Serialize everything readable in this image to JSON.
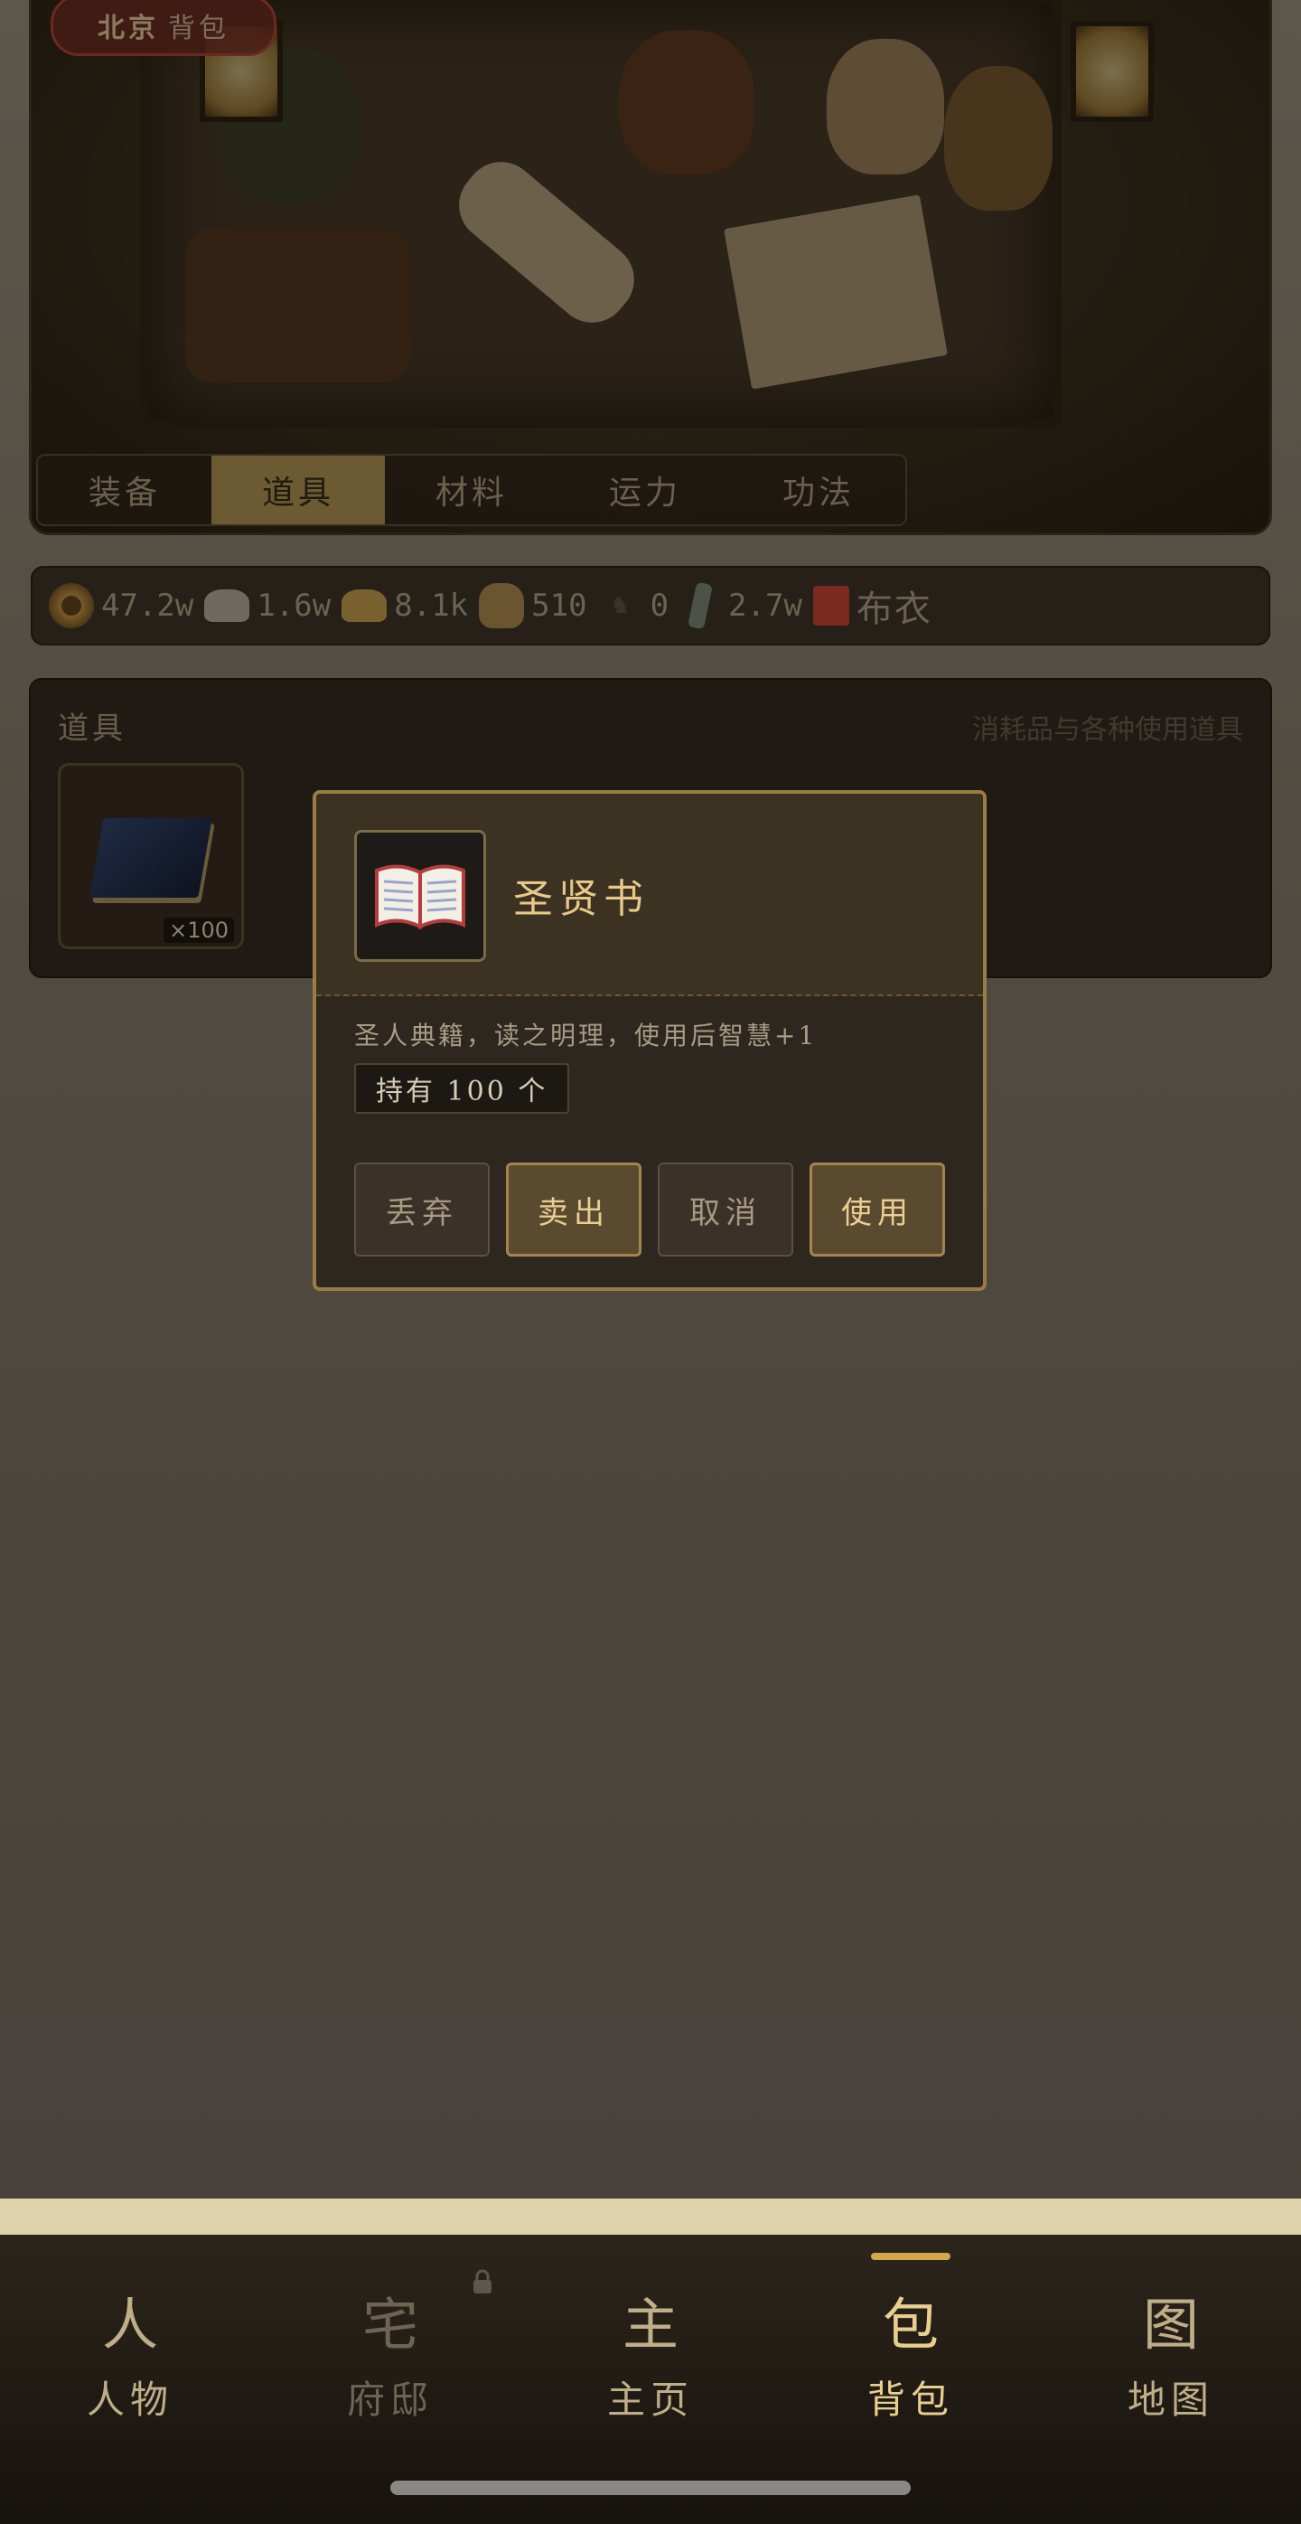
{
  "header": {
    "location_city": "北京",
    "location_page": "背包",
    "tabs": [
      {
        "label": "装备",
        "active": false
      },
      {
        "label": "道具",
        "active": true
      },
      {
        "label": "材料",
        "active": false
      },
      {
        "label": "运力",
        "active": false
      },
      {
        "label": "功法",
        "active": false
      }
    ]
  },
  "resources": [
    {
      "icon": "copper-coin-icon",
      "value": "47.2w"
    },
    {
      "icon": "silver-ingot-icon",
      "value": "1.6w"
    },
    {
      "icon": "gold-ingot-icon",
      "value": "8.1k"
    },
    {
      "icon": "grain-sack-icon",
      "value": "510"
    },
    {
      "icon": "horse-icon",
      "value": "0"
    },
    {
      "icon": "jade-token-icon",
      "value": "2.7w"
    },
    {
      "icon": "cloth-rank-icon",
      "value": "布衣"
    }
  ],
  "items_panel": {
    "title": "道具",
    "hint": "消耗品与各种使用道具",
    "items": [
      {
        "name": "圣贤书",
        "qty_label": "×100"
      }
    ]
  },
  "modal": {
    "item_name": "圣贤书",
    "description": "圣人典籍，读之明理，使用后智慧+1",
    "owned_label": "持有 100 个",
    "buttons": {
      "discard": "丢弃",
      "sell": "卖出",
      "cancel": "取消",
      "use": "使用"
    }
  },
  "nav": [
    {
      "glyph": "人",
      "label": "人物",
      "state": "normal"
    },
    {
      "glyph": "宅",
      "label": "府邸",
      "state": "locked"
    },
    {
      "glyph": "主",
      "label": "主页",
      "state": "normal"
    },
    {
      "glyph": "包",
      "label": "背包",
      "state": "active"
    },
    {
      "glyph": "图",
      "label": "地图",
      "state": "normal"
    }
  ]
}
